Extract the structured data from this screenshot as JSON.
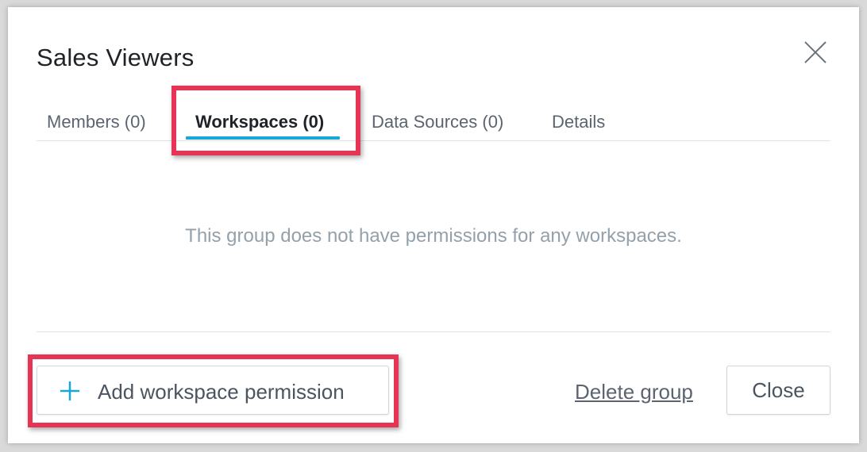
{
  "dialog": {
    "title": "Sales Viewers",
    "close_icon": "close-icon"
  },
  "tabs": [
    {
      "label": "Members (0)",
      "active": false
    },
    {
      "label": "Workspaces (0)",
      "active": true
    },
    {
      "label": "Data Sources (0)",
      "active": false
    },
    {
      "label": "Details",
      "active": false
    }
  ],
  "body": {
    "empty_message": "This group does not have permissions for any workspaces."
  },
  "footer": {
    "add_button_label": "Add workspace permission",
    "add_button_icon": "plus-icon",
    "delete_link_label": "Delete group",
    "close_button_label": "Close"
  },
  "colors": {
    "accent": "#17a8d8",
    "highlight": "#e53454",
    "muted_text": "#94a1ab"
  }
}
